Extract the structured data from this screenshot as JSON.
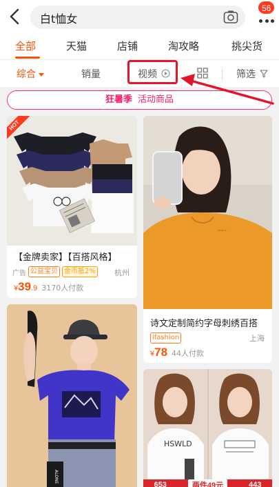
{
  "search": {
    "query": "白t恤女"
  },
  "header": {
    "badge_count": "56"
  },
  "tabs": [
    {
      "label": "全部",
      "active": true
    },
    {
      "label": "天猫"
    },
    {
      "label": "店铺"
    },
    {
      "label": "淘攻略"
    },
    {
      "label": "挑尖货"
    }
  ],
  "filters": {
    "comprehensive": "综合",
    "sales": "销量",
    "video": "视频",
    "filter": "筛选"
  },
  "promo": {
    "primary": "狂暑季",
    "secondary": "活动商品"
  },
  "products": [
    {
      "title": "【金牌卖家】【百搭风格】",
      "ad_label": "广告",
      "tags": [
        "公益宝贝",
        "金币抵2%"
      ],
      "city": "杭州",
      "price_int": "39",
      "price_dec": ".9",
      "sold": "3170人付款",
      "hot": "HOT"
    },
    {
      "title": "诗文定制简约字母刺绣百搭",
      "brand_tag": "ifashion",
      "city": "上海",
      "price_int": "78",
      "sold": "44人付款"
    },
    {
      "banner_left": "653",
      "banner_mid": "两件49元",
      "banner_right": "443"
    }
  ],
  "colors": {
    "accent": "#ff5000",
    "promo": "#ff1a6a",
    "highlight_box": "#e4152a"
  },
  "currency": "¥",
  "image_text": {
    "card4_shirt_left": "HSWLD",
    "card3_shirt_print": "ALONE"
  }
}
